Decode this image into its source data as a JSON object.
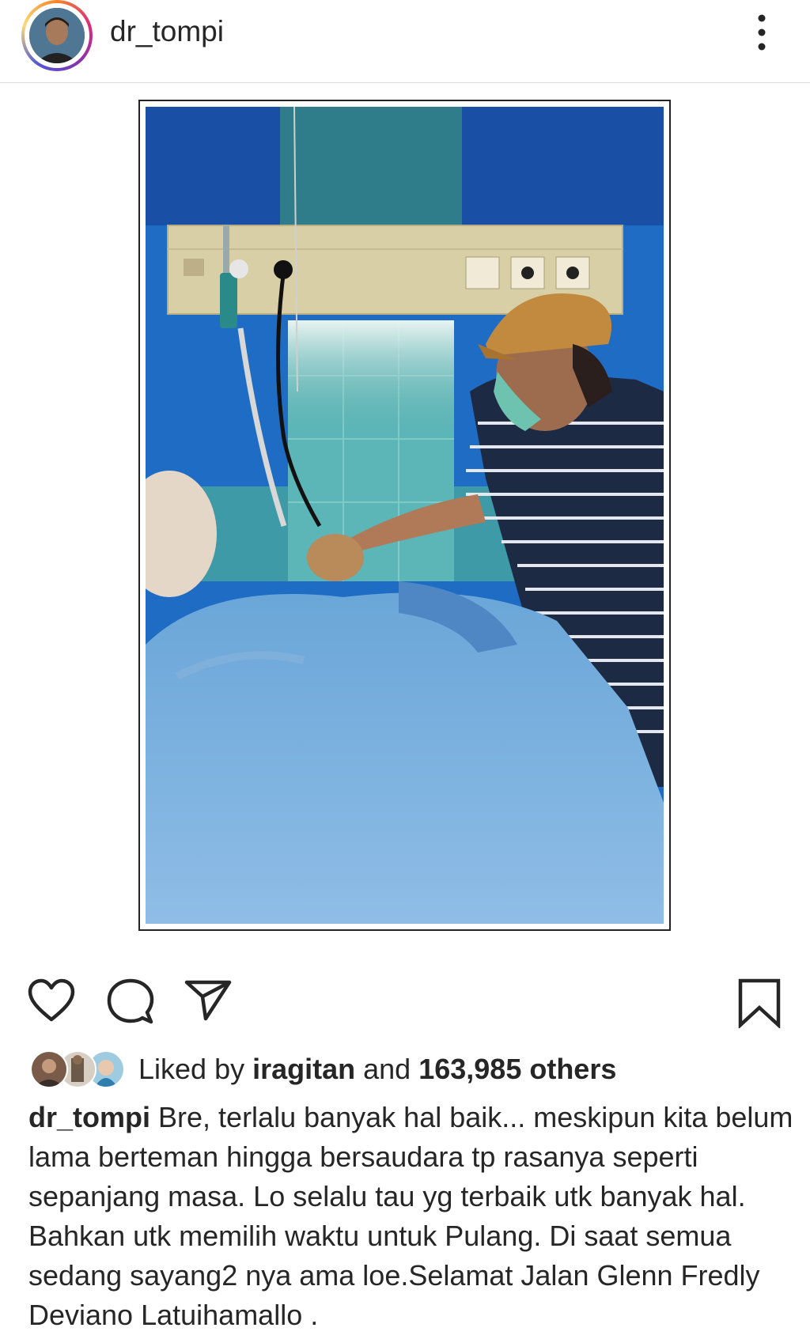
{
  "post": {
    "username": "dr_tompi"
  },
  "header": {
    "more_icon": "vertical-ellipsis-icon"
  },
  "photo": {
    "description_tag": "hospital-room-photo"
  },
  "actions": {
    "like_icon": "heart-outline-icon",
    "comment_icon": "comment-bubble-icon",
    "share_icon": "paper-plane-icon",
    "save_icon": "bookmark-outline-icon"
  },
  "likes": {
    "prefix": "Liked by ",
    "user": "iragitan",
    "middle": " and ",
    "count": "163,985 others"
  },
  "caption": {
    "username": "dr_tompi",
    "text": " Bre, terlalu banyak hal baik... meskipun kita belum lama berteman hingga bersaudara tp rasanya seperti sepanjang masa. Lo selalu tau yg terbaik utk banyak hal. Bahkan utk memilih waktu untuk Pulang. Di saat semua sedang sayang2 nya ama loe.Selamat Jalan Glenn Fredly Deviano Latuihamallo ."
  },
  "colors": {
    "text": "#262626",
    "divider": "#dbdbdb",
    "ring_start": "#f58529",
    "ring_mid": "#dd2a7b",
    "ring_end": "#515bd4"
  }
}
